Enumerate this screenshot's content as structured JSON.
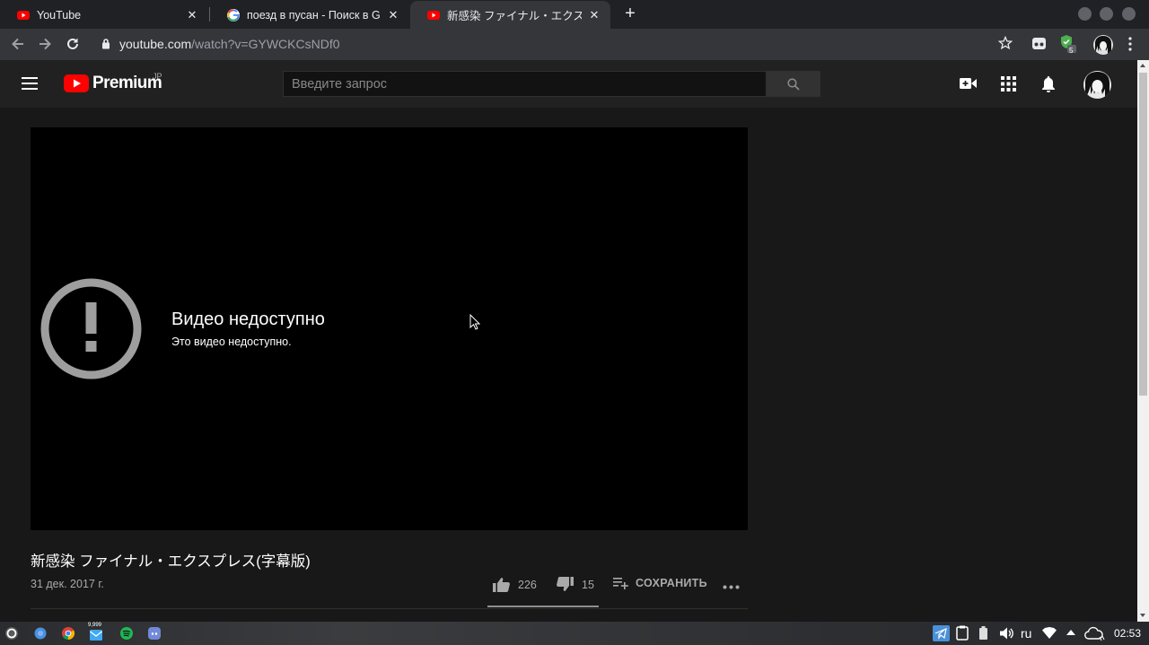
{
  "browser": {
    "tabs": [
      {
        "title": "YouTube",
        "favicon": "youtube-icon",
        "active": false
      },
      {
        "title": "поезд в пусан - Поиск в Goo",
        "favicon": "google-icon",
        "active": false
      },
      {
        "title": "新感染 ファイナル・エクスプ",
        "favicon": "youtube-icon",
        "active": true
      }
    ],
    "url_host": "youtube.com",
    "url_path": "/watch?v=GYWCKCsNDf0",
    "extension_badge": "5"
  },
  "masthead": {
    "logo_text": "Premium",
    "country_code": "JP",
    "search_placeholder": "Введите запрос"
  },
  "player": {
    "error_title": "Видео недоступно",
    "error_subtitle": "Это видео недоступно."
  },
  "video": {
    "title": "新感染 ファイナル・エクスプレス(字幕版)",
    "date": "31 дек. 2017 г.",
    "likes": "226",
    "dislikes": "15",
    "save_label": "СОХРАНИТЬ",
    "like_ratio": 0.938
  },
  "taskbar": {
    "badge": "9,999",
    "language": "ru",
    "clock": "02:53"
  },
  "colors": {
    "youtube_red": "#ff0000",
    "background": "#181818",
    "masthead": "#212121",
    "chrome_frame": "#202124"
  }
}
